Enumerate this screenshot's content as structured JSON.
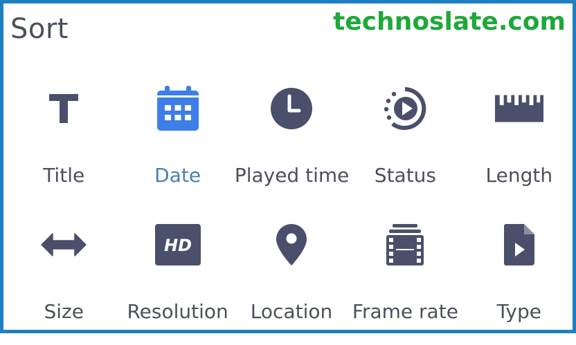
{
  "header": {
    "title": "Sort",
    "watermark": "technoslate.com"
  },
  "colors": {
    "icon": "#4a4f6b",
    "active_icon": "#3d7ee9",
    "active_label": "#4a7fb8",
    "label": "#4b505c",
    "border": "#1e7fc2",
    "watermark": "#1fa83a"
  },
  "sort_options": [
    {
      "label": "Title",
      "icon": "title-icon",
      "active": false
    },
    {
      "label": "Date",
      "icon": "calendar-icon",
      "active": true
    },
    {
      "label": "Played time",
      "icon": "clock-icon",
      "active": false
    },
    {
      "label": "Status",
      "icon": "play-status-icon",
      "active": false
    },
    {
      "label": "Length",
      "icon": "ruler-icon",
      "active": false
    },
    {
      "label": "Size",
      "icon": "horizontal-arrows-icon",
      "active": false
    },
    {
      "label": "Resolution",
      "icon": "hd-icon",
      "active": false
    },
    {
      "label": "Location",
      "icon": "location-pin-icon",
      "active": false
    },
    {
      "label": "Frame rate",
      "icon": "film-icon",
      "active": false
    },
    {
      "label": "Type",
      "icon": "video-file-icon",
      "active": false
    }
  ]
}
